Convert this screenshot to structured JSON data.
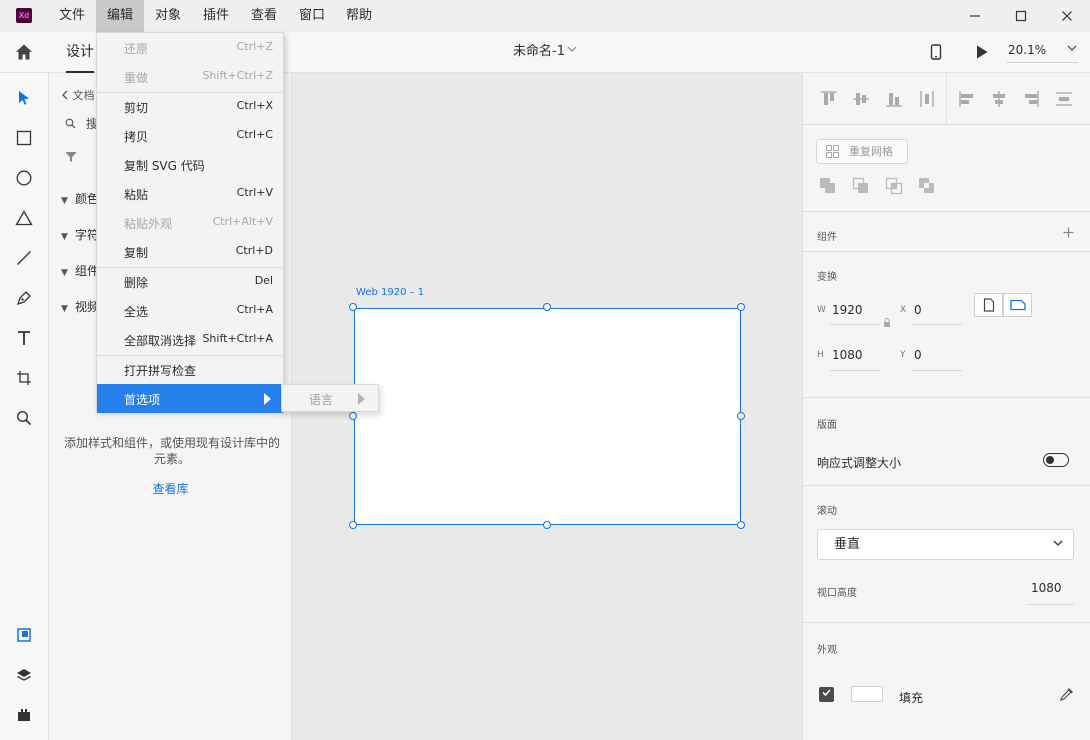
{
  "app": {
    "logo_text": "Xd"
  },
  "menubar": [
    "文件",
    "编辑",
    "对象",
    "插件",
    "查看",
    "窗口",
    "帮助"
  ],
  "window_controls": {
    "minimize": "—",
    "maximize": "☐",
    "close": "✕"
  },
  "toolbar": {
    "tab_design": "设计",
    "document_title": "未命名-1",
    "zoom": "20.1%"
  },
  "library": {
    "back_label": "文档",
    "search_label": "搜",
    "sections": [
      "颜色",
      "字符",
      "组件",
      "视频"
    ],
    "empty_text": "添加样式和组件，或使用现有设计库中的元素。",
    "view_library_link": "查看库"
  },
  "canvas": {
    "artboard_label": "Web 1920 – 1"
  },
  "edit_menu": {
    "items": [
      {
        "label": "还原",
        "shortcut": "Ctrl+Z",
        "disabled": true
      },
      {
        "label": "重做",
        "shortcut": "Shift+Ctrl+Z",
        "disabled": true
      },
      {
        "label": "剪切",
        "shortcut": "Ctrl+X",
        "disabled": false
      },
      {
        "label": "拷贝",
        "shortcut": "Ctrl+C",
        "disabled": false
      },
      {
        "label": "复制 SVG 代码",
        "shortcut": "",
        "disabled": false
      },
      {
        "label": "粘贴",
        "shortcut": "Ctrl+V",
        "disabled": false
      },
      {
        "label": "粘贴外观",
        "shortcut": "Ctrl+Alt+V",
        "disabled": true
      },
      {
        "label": "复制",
        "shortcut": "Ctrl+D",
        "disabled": false
      },
      {
        "label": "删除",
        "shortcut": "Del",
        "disabled": false
      },
      {
        "label": "全选",
        "shortcut": "Ctrl+A",
        "disabled": false
      },
      {
        "label": "全部取消选择",
        "shortcut": "Shift+Ctrl+A",
        "disabled": false
      },
      {
        "label": "打开拼写检查",
        "shortcut": "",
        "disabled": false
      },
      {
        "label": "首选项",
        "shortcut": "",
        "disabled": false,
        "highlighted": true,
        "has_submenu": true
      }
    ],
    "submenu": {
      "label": "语言",
      "disabled": true
    }
  },
  "properties": {
    "repeat_grid_label": "重复网格",
    "component_title": "组件",
    "transform_title": "变换",
    "w_label": "W",
    "w_value": "1920",
    "h_label": "H",
    "h_value": "1080",
    "x_label": "X",
    "x_value": "0",
    "y_label": "Y",
    "y_value": "0",
    "artboard_title": "版面",
    "responsive_label": "响应式调整大小",
    "responsive_on": false,
    "scroll_title": "滚动",
    "scroll_value": "垂直",
    "viewport_label": "视口高度",
    "viewport_value": "1080",
    "appearance_title": "外观",
    "fill_label": "填充",
    "fill_checked": true,
    "fill_color": "#FFFFFF"
  },
  "colors": {
    "accent": "#1473e6",
    "menu_highlight": "#2680eb",
    "xd_logo_bg": "#470137",
    "xd_logo_fg": "#ff61f6"
  }
}
